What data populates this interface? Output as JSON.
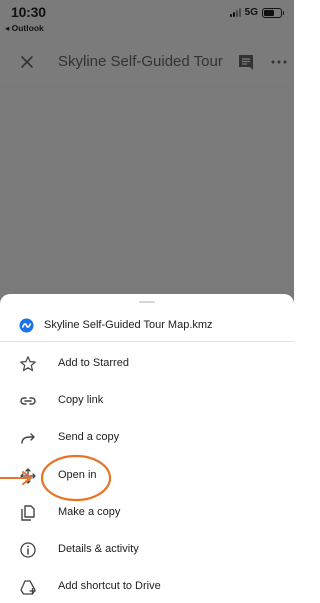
{
  "status_bar": {
    "time": "10:30",
    "back_app": "◂ Outlook",
    "network": "5G"
  },
  "app_bar": {
    "title": "Skyline Self-Guided Tour M..."
  },
  "sheet": {
    "file_name": "Skyline Self-Guided Tour Map.kmz",
    "items": [
      {
        "label": "Add to Starred",
        "icon": "star-outline-icon"
      },
      {
        "label": "Copy link",
        "icon": "link-icon"
      },
      {
        "label": "Send a copy",
        "icon": "share-arrow-icon"
      },
      {
        "label": "Open in",
        "icon": "open-in-icon"
      },
      {
        "label": "Make a copy",
        "icon": "copy-icon"
      },
      {
        "label": "Details & activity",
        "icon": "info-icon"
      },
      {
        "label": "Add shortcut to Drive",
        "icon": "drive-shortcut-icon"
      }
    ]
  },
  "colors": {
    "dim_overlay": "#7b7b7b",
    "highlight": "#e8742a",
    "file_icon": "#1a73e8"
  }
}
